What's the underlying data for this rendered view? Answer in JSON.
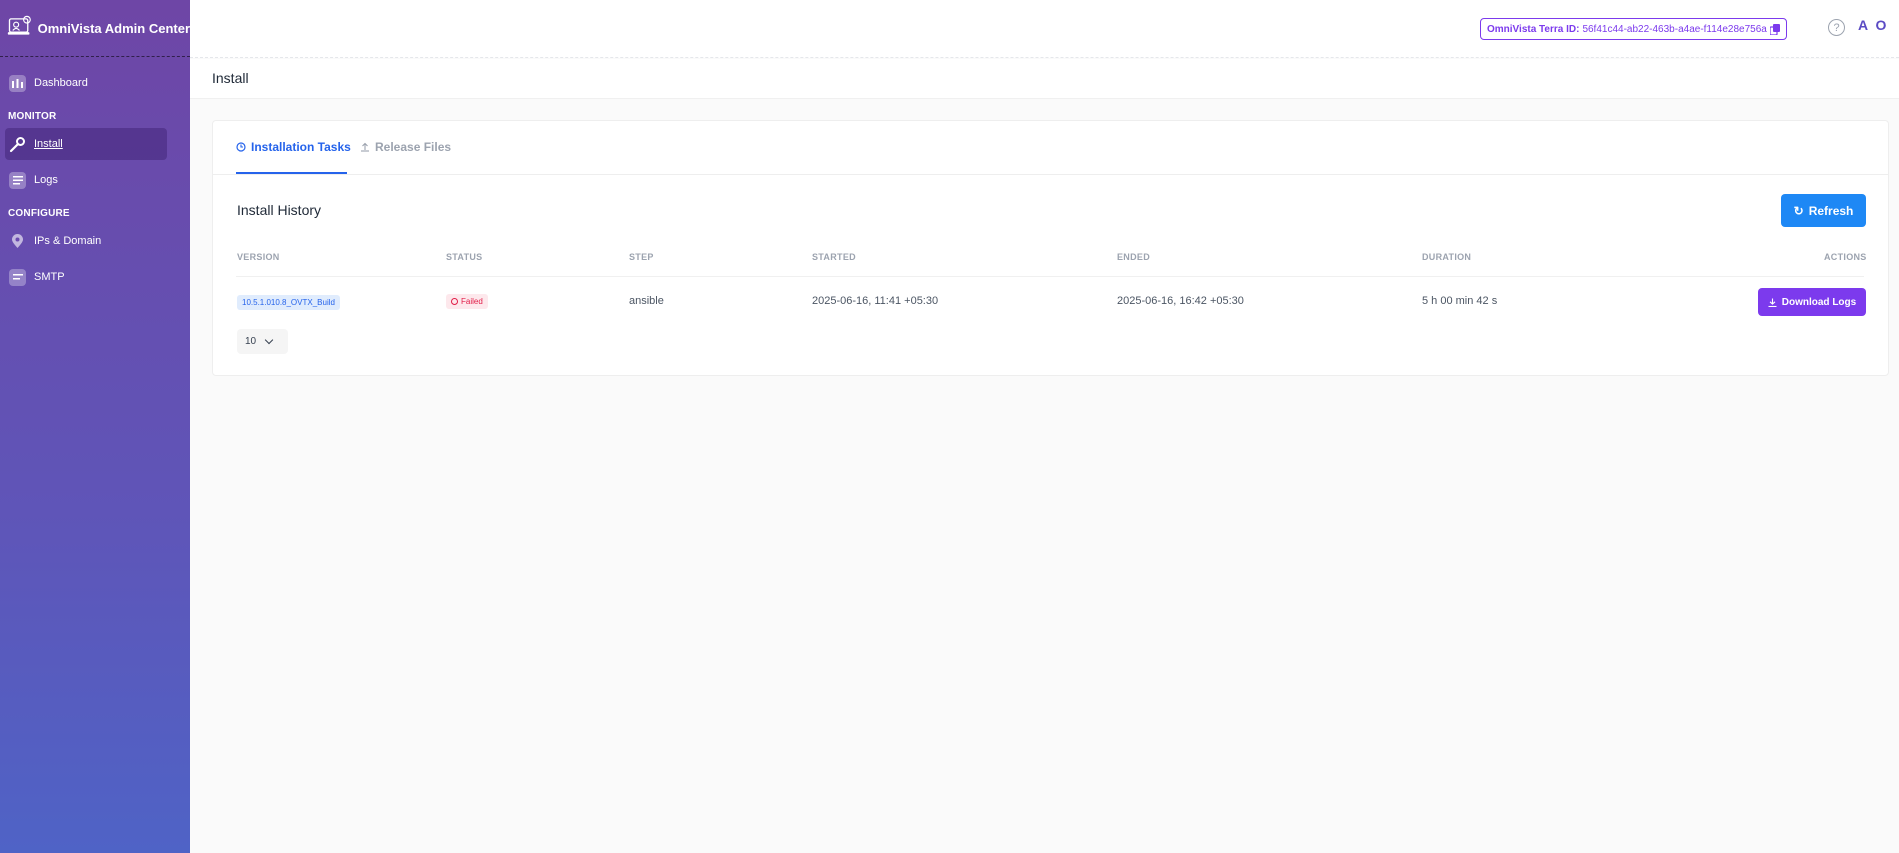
{
  "brand": {
    "title": "OmniVista Admin Center"
  },
  "sidebar": {
    "dashboard": "Dashboard",
    "section_monitor": "MONITOR",
    "install": "Install",
    "logs": "Logs",
    "section_configure": "CONFIGURE",
    "ips_domain": "IPs & Domain",
    "smtp": "SMTP"
  },
  "header": {
    "terra_label": "OmniVista Terra ID:",
    "terra_value": "56f41c44-ab22-463b-a4ae-f114e28e756a",
    "help": "?",
    "avatar": "A O"
  },
  "page": {
    "title": "Install"
  },
  "tabs": [
    {
      "label": "Installation Tasks",
      "active": true
    },
    {
      "label": "Release Files",
      "active": false
    }
  ],
  "history": {
    "title": "Install History",
    "refresh_label": "Refresh",
    "columns": [
      "VERSION",
      "STATUS",
      "STEP",
      "STARTED",
      "ENDED",
      "DURATION",
      "ACTIONS"
    ],
    "rows": [
      {
        "version": "10.5.1.010.8_OVTX_Build",
        "status": "Failed",
        "step": "ansible",
        "started": "2025-06-16, 11:41 +05:30",
        "ended": "2025-06-16, 16:42 +05:30",
        "duration": "5 h 00 min 42 s",
        "action": "Download Logs"
      }
    ],
    "page_size": "10"
  },
  "colors": {
    "accent": "#7c3aed",
    "primary": "#1e88f5",
    "danger": "#e11d48"
  }
}
